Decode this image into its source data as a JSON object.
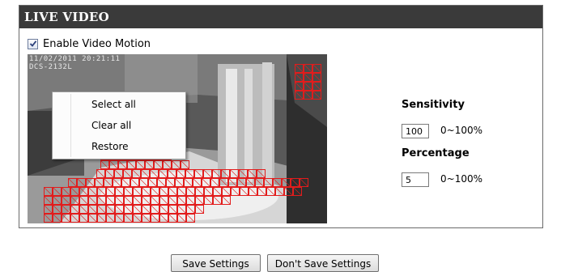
{
  "panel": {
    "title": "LIVE VIDEO"
  },
  "motion": {
    "enable_label": "Enable Video Motion",
    "enabled": true
  },
  "video": {
    "timestamp": "11/02/2011 20:21:11",
    "camera_id": "DCS-2132L"
  },
  "context_menu": {
    "items": [
      "Select all",
      "Clear all",
      "Restore"
    ]
  },
  "sensitivity": {
    "label": "Sensitivity",
    "value": "100",
    "range": "0~100%"
  },
  "percentage": {
    "label": "Percentage",
    "value": "5",
    "range": "0~100%"
  },
  "buttons": {
    "save": "Save Settings",
    "dont_save": "Don't Save Settings"
  },
  "colors": {
    "header_bg": "#3a3a3a",
    "motion_grid": "#e21c1c"
  },
  "icons": {
    "checkbox": "checkmark-icon"
  }
}
